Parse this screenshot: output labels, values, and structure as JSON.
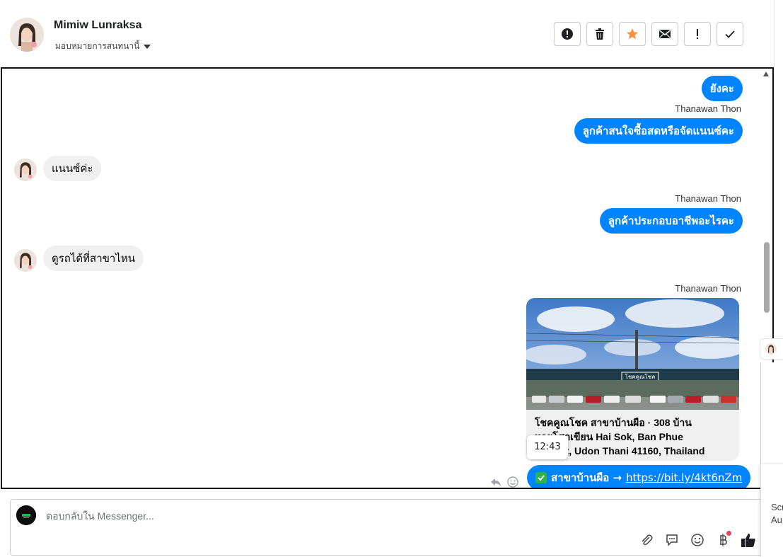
{
  "header": {
    "contact_name": "Mimiw Lunraksa",
    "assign_label": "มอบหมายการสนทนานี้",
    "actions": [
      {
        "name": "report-icon"
      },
      {
        "name": "trash-icon"
      },
      {
        "name": "star-icon",
        "color": "#f7923a"
      },
      {
        "name": "mail-icon"
      },
      {
        "name": "exclamation-icon"
      },
      {
        "name": "checkmark-icon"
      }
    ]
  },
  "messages": {
    "m1": "ยังคะ",
    "sender1": "Thanawan Thon",
    "m2": "ลูกค้าสนใจซื้อสดหรือจัดแนนซ์คะ",
    "m3": "แนนซ์ค่ะ",
    "sender2": "Thanawan Thon",
    "m4": "ลูกค้าประกอบอาชีพอะไรคะ",
    "m5": "ดูรถได้ที่สาขาไหน",
    "sender3": "Thanawan Thon",
    "card_line1": "โชคคูณโชค สาขาบ้านผือ · 308 บ้าน",
    "card_line2": "หายโศกเขียน Hai Sok, Ban Phue",
    "card_line3": "District, Udon Thani 41160, Thailand",
    "card_sign": "โชคคูณโชค",
    "time_tooltip": "12:43",
    "link_prefix": "สาขาบ้านผือ →",
    "link_url": "https://bit.ly/4kt6nZm"
  },
  "composer": {
    "placeholder": "ตอบกลับใน Messenger..."
  },
  "side": {
    "line1": "Scr",
    "line2": "Au"
  },
  "colors": {
    "accent": "#0084ff",
    "incoming": "#f0f0f0",
    "check": "#2fb34a",
    "badge": "#e8455b"
  }
}
